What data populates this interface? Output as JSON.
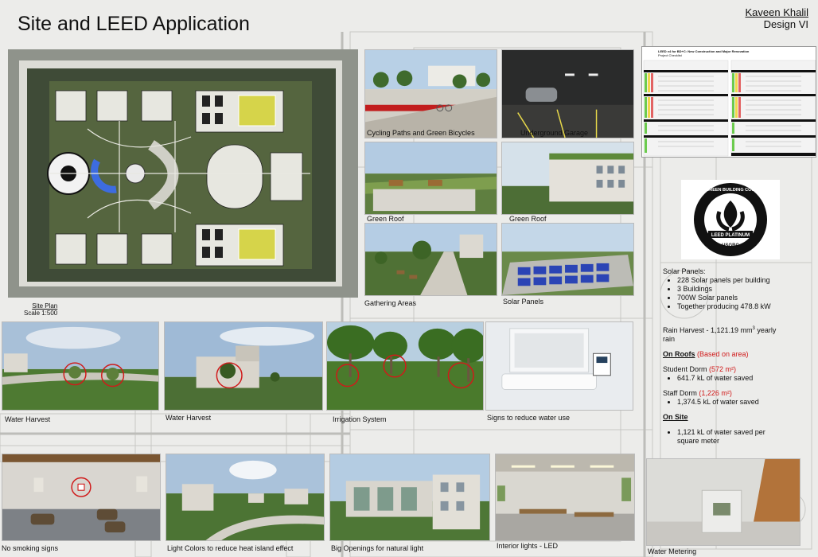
{
  "page": {
    "title": "Site and LEED Application",
    "author": "Kaveen Khalil",
    "course": "Design VI"
  },
  "site_plan": {
    "label": "Site Plan",
    "scale": "Scale 1:500"
  },
  "photos": {
    "cycling": "Cycling Paths and Green Bicycles",
    "garage": "Underground Garage",
    "green_roof_1": "Green Roof",
    "green_roof_2": "Green Roof",
    "gathering": "Gathering Areas",
    "solar": "Solar Panels",
    "water_harvest_1": "Water Harvest",
    "water_harvest_2": "Water Harvest",
    "irrigation": "Irrigation System",
    "signs_water": "Signs to reduce water use",
    "no_smoking": "No smoking signs",
    "light_colors": "Light Colors to reduce heat island effect",
    "big_openings": "Big Openings for natural light",
    "interior_lights": "Interior lights - LED",
    "water_metering": "Water Metering"
  },
  "leed_badge": {
    "ring": "U.S. GREEN BUILDING COUNCIL",
    "level": "LEED PLATINUM",
    "org": "USGBC"
  },
  "checklist": {
    "heading": "LEED v4 for BD+C: New Construction and Major Renovation",
    "sub": "Project Checklist"
  },
  "solar_panels": {
    "heading": "Solar Panels:",
    "items": [
      "228 Solar panels per building",
      "3 Buildings",
      "700W Solar panels",
      "Together producing 478.8 kW"
    ]
  },
  "rain": {
    "line": "Rain Harvest - 1,121.19 mm",
    "sup": "3",
    "line_end": " yearly",
    "line2": "rain",
    "on_roofs": "On Roofs",
    "based": "(Based on area)",
    "student_label": "Student Dorm",
    "student_area": "(572 m²)",
    "student_saved": "641.7 kL of water saved",
    "staff_label": "Staff Dorm",
    "staff_area": "(1,226 m²)",
    "staff_saved": "1,374.5 kL of water saved",
    "on_site": "On Site",
    "site_saved_1": "1,121 kL of water saved per",
    "site_saved_2": "square meter"
  },
  "colors": {
    "accent_red": "#d01a1a",
    "grass": "#4e6a3c",
    "sky": "#a9c3dd"
  }
}
